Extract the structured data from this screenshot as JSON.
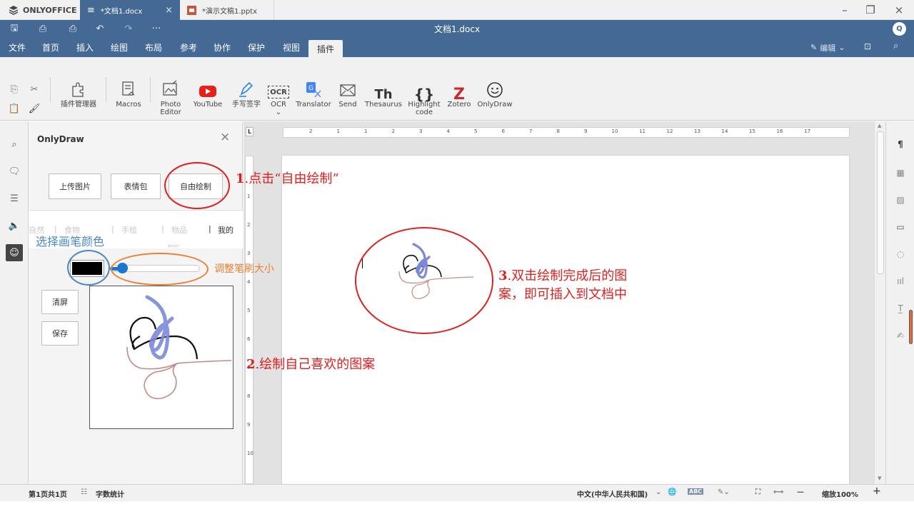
{
  "app": {
    "brand": "ONLYOFFICE",
    "tabs": [
      {
        "label": "*文档1.docx",
        "type": "document"
      },
      {
        "label": "*演示文稿1.pptx",
        "type": "presentation"
      }
    ],
    "window_controls": [
      "minimize-icon",
      "restore-icon",
      "close-icon"
    ]
  },
  "titlebar": {
    "title": "文档1.docx",
    "avatar": "Q",
    "quick_icons": [
      "save-icon",
      "print-icon",
      "quick-print-icon",
      "undo-icon",
      "redo-icon",
      "more-icon"
    ]
  },
  "menubar": {
    "items": [
      "文件",
      "首页",
      "插入",
      "绘图",
      "布局",
      "参考",
      "协作",
      "保护",
      "视图",
      "插件"
    ],
    "active": "插件",
    "edit_mode": "编辑"
  },
  "toolbar": {
    "plugins": [
      {
        "label": "插件管理器",
        "icon": "plugin-manager-icon"
      },
      {
        "label": "Macros",
        "icon": "macros-icon"
      },
      {
        "label": "Photo\nEditor",
        "icon": "photo-editor-icon"
      },
      {
        "label": "YouTube",
        "icon": "youtube-icon"
      },
      {
        "label": "手写签字",
        "icon": "signature-icon"
      },
      {
        "label": "OCR",
        "icon": "ocr-icon"
      },
      {
        "label": "Translator",
        "icon": "translator-icon"
      },
      {
        "label": "Send",
        "icon": "send-icon"
      },
      {
        "label": "Thesaurus",
        "icon": "thesaurus-icon"
      },
      {
        "label": "Highlight\ncode",
        "icon": "highlight-code-icon"
      },
      {
        "label": "Zotero",
        "icon": "zotero-icon"
      },
      {
        "label": "OnlyDraw",
        "icon": "onlydraw-icon"
      }
    ],
    "ocr_glyph": "OCR",
    "thesaurus_glyph": "Th",
    "code_glyph": "{}",
    "zotero_glyph": "Z"
  },
  "panel": {
    "title": "OnlyDraw",
    "buttons": {
      "upload": "上传图片",
      "emoji": "表情包",
      "free_draw": "自由绘制",
      "clear": "清屏",
      "save": "保存"
    },
    "categories": [
      "自然",
      "食物",
      "手绘",
      "物品",
      "我的"
    ],
    "brush_color": "#000000",
    "brush_size": 0.1
  },
  "statusbar": {
    "page": "第1页共1页",
    "word_count": "字数统计",
    "language": "中文(中华人民共和国)",
    "zoom": "缩放100%"
  },
  "ruler": {
    "h_numbers": [
      "2",
      "1",
      "1",
      "2",
      "3",
      "4",
      "5",
      "6",
      "7",
      "8",
      "9",
      "10",
      "11",
      "12",
      "13",
      "14",
      "15",
      "16",
      "17"
    ],
    "v_numbers": [
      "1",
      "2",
      "3",
      "4",
      "5",
      "6",
      "7",
      "8",
      "9",
      "10"
    ]
  },
  "annotations": {
    "step1_num": "1",
    "step1_text": ".点击“自由绘制”",
    "step2_num": "2",
    "step2_text": ".绘制自己喜欢的图案",
    "step3_num": "3",
    "step3_line1": ".双击绘制完成后的图",
    "step3_line2": "案，即可插入到文档中",
    "pick_color": "选择画笔颜色",
    "brush_size": "调整笔刷大小"
  },
  "colors": {
    "accent": "#446995",
    "annotation_red": "#e02020",
    "annotation_blue": "#4a86c8",
    "annotation_orange": "#ed7d31",
    "slider_blue": "#1976d2"
  }
}
